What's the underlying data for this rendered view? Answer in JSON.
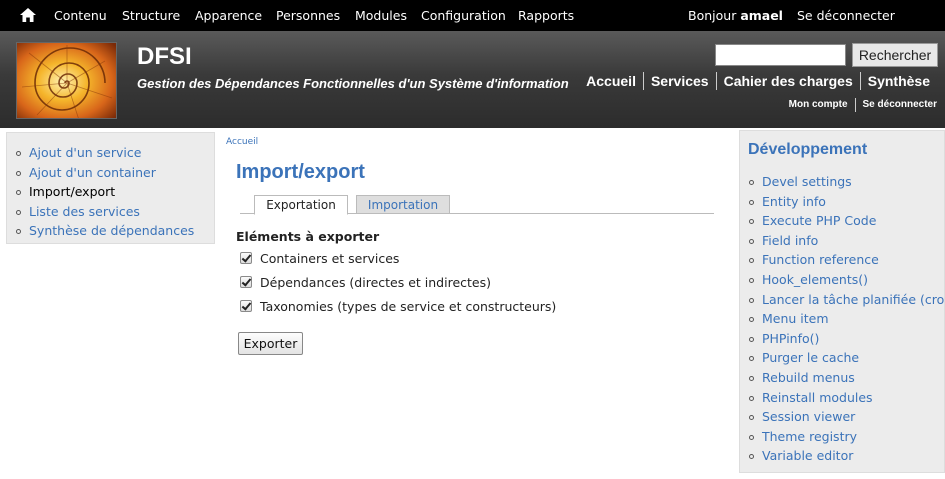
{
  "toolbar": {
    "items": [
      "Contenu",
      "Structure",
      "Apparence",
      "Personnes",
      "Modules",
      "Configuration",
      "Rapports"
    ],
    "greeting": "Bonjour",
    "username": "amael",
    "logout": "Se déconnecter",
    "home_icon": "home-icon"
  },
  "header": {
    "site_name": "DFSI",
    "slogan": "Gestion des Dépendances Fonctionnelles d'un Système d'information",
    "search": {
      "value": "",
      "button": "Rechercher"
    },
    "primary_links": [
      "Accueil",
      "Services",
      "Cahier des charges",
      "Synthèse"
    ],
    "secondary_links": [
      "Mon compte",
      "Se déconnecter"
    ]
  },
  "sidebar_first": {
    "items": [
      {
        "label": "Ajout d'un service",
        "active": false
      },
      {
        "label": "Ajout d'un container",
        "active": false
      },
      {
        "label": "Import/export",
        "active": true
      },
      {
        "label": "Liste des services",
        "active": false
      },
      {
        "label": "Synthèse de dépendances",
        "active": false
      }
    ]
  },
  "main": {
    "breadcrumb": "Accueil",
    "title": "Import/export",
    "tabs": [
      {
        "label": "Exportation",
        "active": true
      },
      {
        "label": "Importation",
        "active": false
      }
    ],
    "elements_heading": "Eléments à exporter",
    "checkboxes": [
      {
        "label": "Containers et services",
        "checked": true
      },
      {
        "label": "Dépendances (directes et indirectes)",
        "checked": true
      },
      {
        "label": "Taxonomies (types de service et constructeurs)",
        "checked": true
      }
    ],
    "export_button": "Exporter"
  },
  "sidebar_second": {
    "title": "Développement",
    "items": [
      "Devel settings",
      "Entity info",
      "Execute PHP Code",
      "Field info",
      "Function reference",
      "Hook_elements()",
      "Lancer la tâche planifiée (cron)",
      "Menu item",
      "PHPinfo()",
      "Purger le cache",
      "Rebuild menus",
      "Reinstall modules",
      "Session viewer",
      "Theme registry",
      "Variable editor"
    ]
  },
  "colors": {
    "link": "#3b73b9",
    "toolbar_bg": "#000000",
    "header_bg": "#3a3a3a",
    "sidebar_bg": "#ececec"
  }
}
